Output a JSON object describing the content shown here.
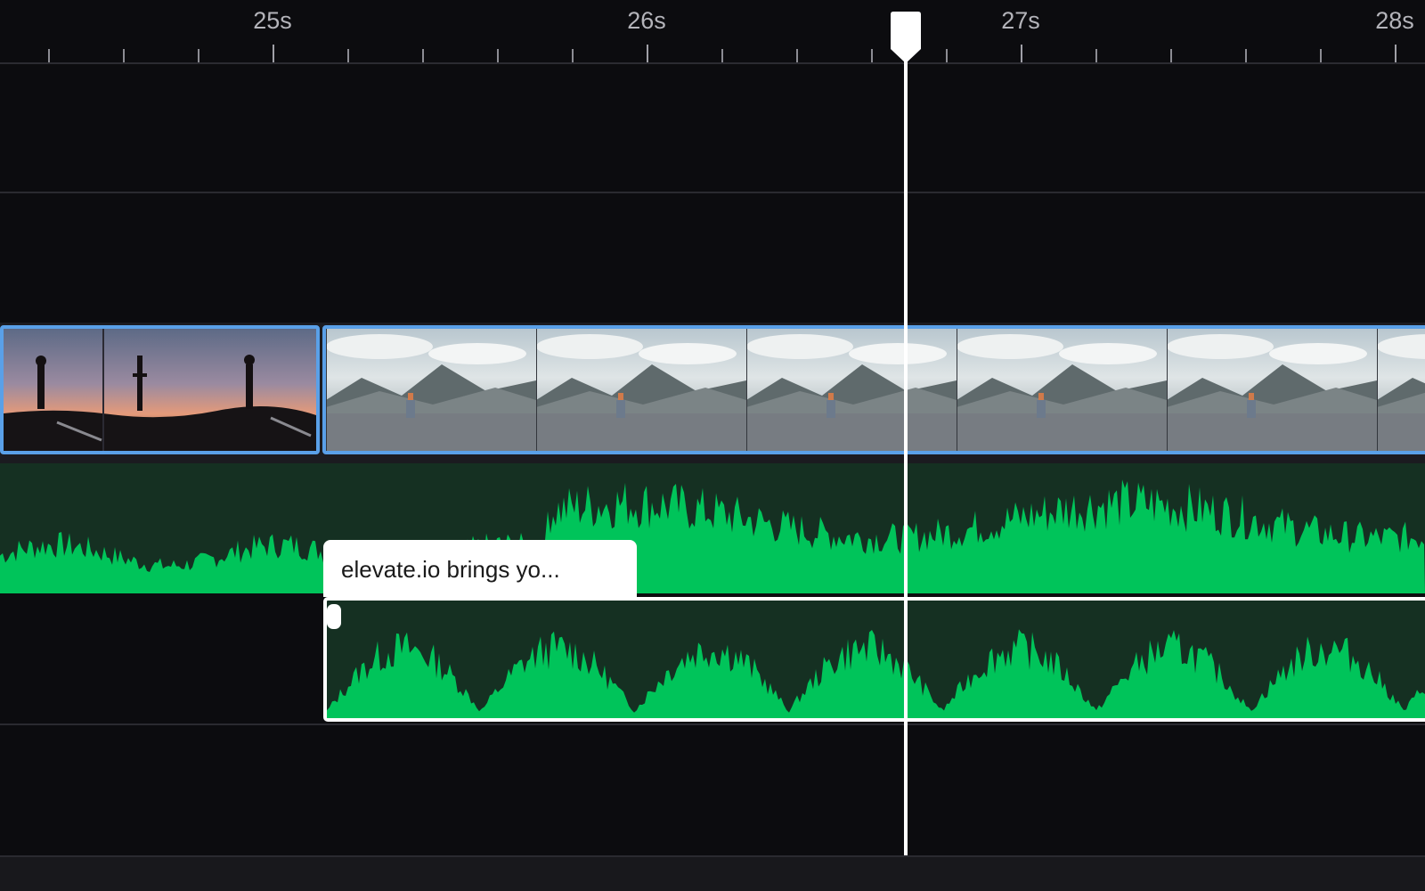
{
  "ruler": {
    "labels": [
      "25s",
      "26s",
      "27s",
      "28s"
    ]
  },
  "tracks": {
    "video_clips": [
      {
        "scene": "sunset-silhouette"
      },
      {
        "scene": "mountain-road-skater"
      }
    ],
    "voiceover": {
      "caption": "elevate.io brings yo..."
    }
  },
  "playhead": {
    "time_s": 26.7
  },
  "colors": {
    "background": "#0c0c0f",
    "clip_selection": "#5aa0e8",
    "waveform": "#00c45a",
    "waveform_bg": "#153022",
    "playhead": "#ffffff"
  }
}
